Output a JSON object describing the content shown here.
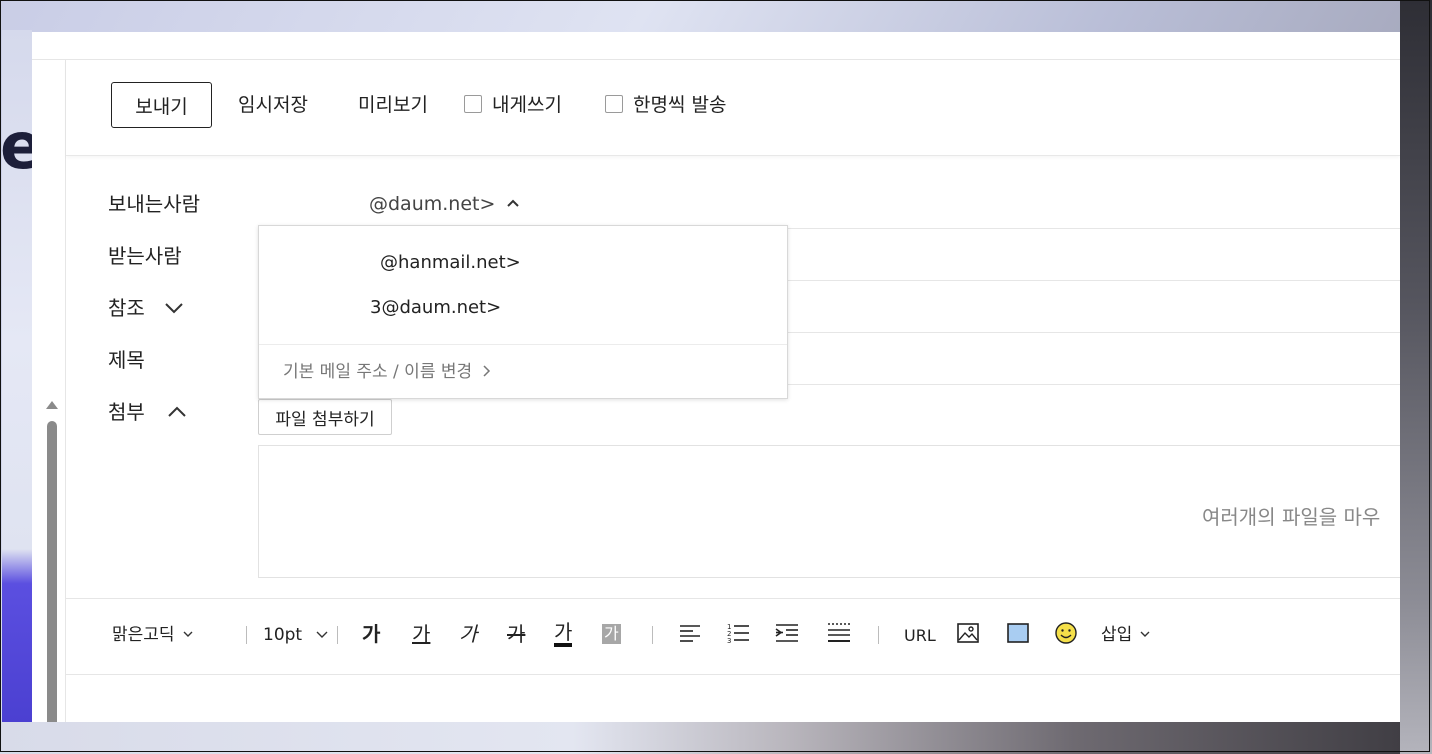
{
  "toolbar": {
    "send": "보내기",
    "save_draft": "임시저장",
    "preview": "미리보기",
    "to_self": "내게쓰기",
    "individual_send": "한명씩 발송"
  },
  "fields": {
    "sender_label": "보내는사람",
    "sender_value": "@daum.net>",
    "recipient_label": "받는사람",
    "cc_label": "참조",
    "subject_label": "제목",
    "attachment_label": "첨부"
  },
  "sender_dropdown": {
    "options": [
      "@hanmail.net>",
      "3@daum.net>"
    ],
    "change_link": "기본 메일 주소 / 이름 변경"
  },
  "attachment": {
    "button": "파일 첨부하기",
    "dropzone_hint": "여러개의 파일을 마우"
  },
  "editor_toolbar": {
    "font": "맑은고딕",
    "size": "10pt",
    "bold": "가",
    "underline": "가",
    "italic": "가",
    "strike": "가",
    "font_color": "가",
    "bg_color": "가",
    "url": "URL",
    "insert": "삽입"
  },
  "icons": {
    "font_color_bar": "#111111",
    "bg_color_fill": "#a7a7a7",
    "table_fill": "#a9cdf2",
    "emoji_fill": "#f5e04a"
  }
}
